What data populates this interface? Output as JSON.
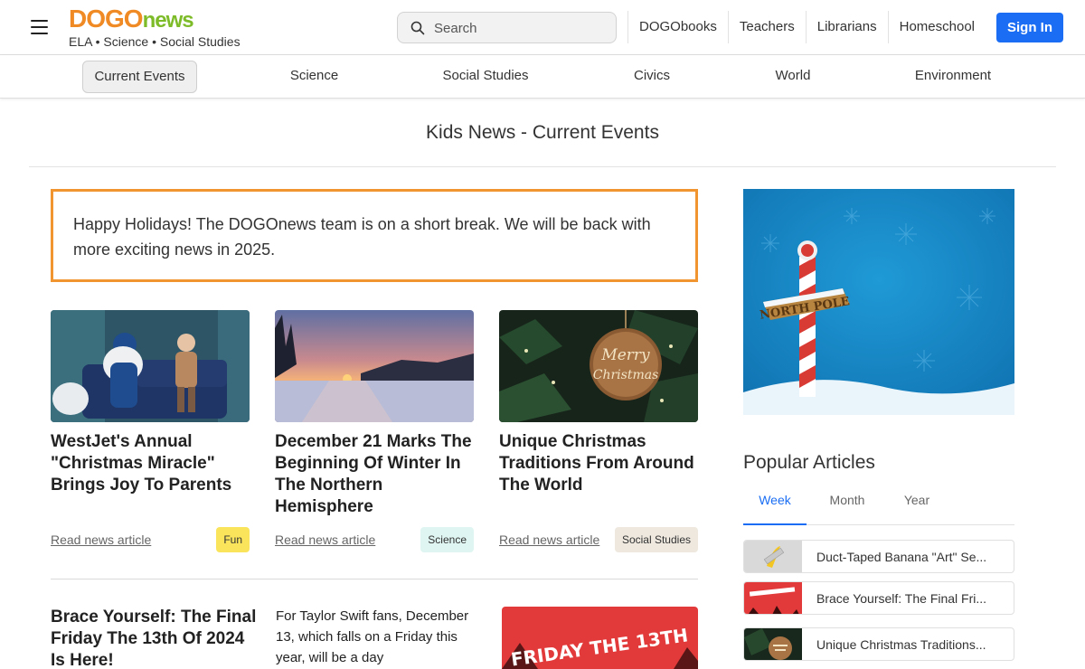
{
  "header": {
    "logo_dogo": "DOGO",
    "logo_news": "news",
    "tagline": "ELA • Science • Social Studies",
    "search_placeholder": "Search",
    "links": [
      "DOGObooks",
      "Teachers",
      "Librarians",
      "Homeschool"
    ],
    "signin_label": "Sign In"
  },
  "categories": [
    "Current Events",
    "Science",
    "Social Studies",
    "Civics",
    "World",
    "Environment"
  ],
  "active_category": "Current Events",
  "page_title": "Kids News - Current Events",
  "notice": "Happy Holidays! The DOGOnews team is on a short break. We will be back with more exciting news in 2025.",
  "articles": [
    {
      "title": "WestJet's Annual \"Christmas Miracle\" Brings Joy To Parents",
      "read": "Read news article",
      "tag": "Fun",
      "tag_color": "#f9e45b"
    },
    {
      "title": "December 21 Marks The Beginning Of Winter In The Northern Hemisphere",
      "read": "Read news article",
      "tag": "Science",
      "tag_color": "#dff5f1"
    },
    {
      "title": "Unique Christmas Traditions From Around The World",
      "read": "Read news article",
      "tag": "Social Studies",
      "tag_color": "#eee8df"
    }
  ],
  "featured": {
    "title": "Brace Yourself: The Final Friday The 13th Of 2024 Is Here!",
    "excerpt": "For Taylor Swift fans, December 13, which falls on a Friday this year, will be a day",
    "image_text": "FRIDAY THE 13TH"
  },
  "sidebar": {
    "sign_text": "NORTH POLE",
    "popular_heading": "Popular Articles",
    "tabs": [
      "Week",
      "Month",
      "Year"
    ],
    "active_tab": "Week",
    "items": [
      "Duct-Taped Banana \"Art\" Se...",
      "Brace Yourself: The Final Fri...",
      "Unique Christmas Traditions..."
    ]
  },
  "colors": {
    "accent_blue": "#1b6ef3",
    "notice_border": "#f0952f",
    "logo_orange": "#f08a24",
    "logo_green": "#7dbb28"
  }
}
